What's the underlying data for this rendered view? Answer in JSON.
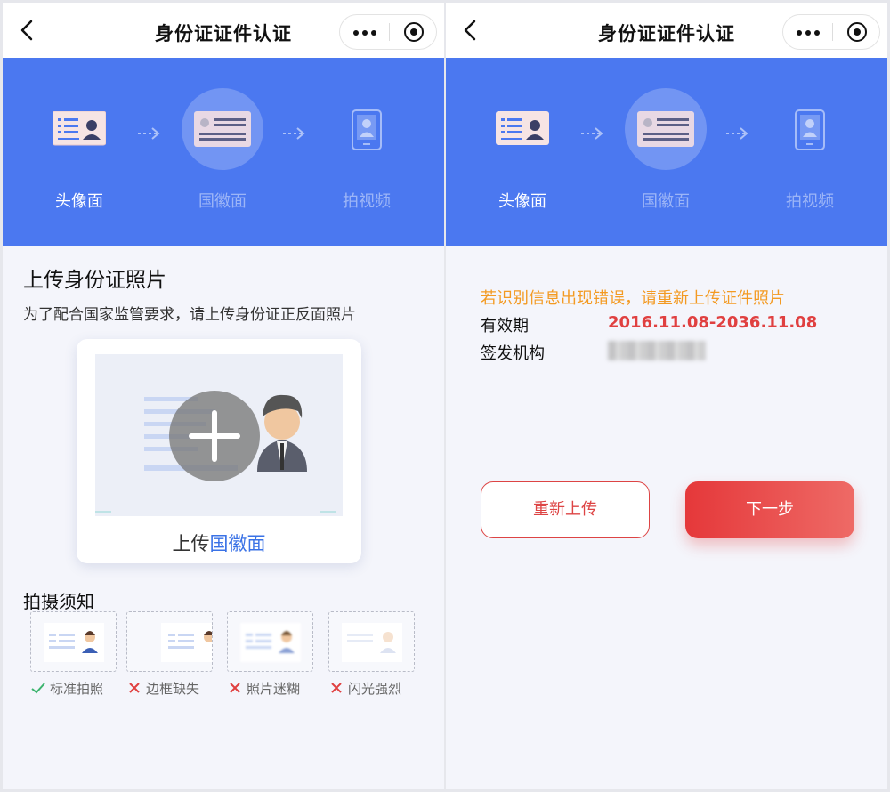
{
  "nav": {
    "title": "身份证证件认证"
  },
  "steps": [
    {
      "label": "头像面",
      "state": "done"
    },
    {
      "label": "国徽面",
      "state": "current"
    },
    {
      "label": "拍视频",
      "state": "pending"
    }
  ],
  "left": {
    "title": "上传身份证照片",
    "description": "为了配合国家监管要求，请上传身份证正反面照片",
    "upload_prefix": "上传",
    "upload_side": "国徽面",
    "tips_title": "拍摄须知",
    "tips": [
      {
        "label": "标准拍照",
        "ok": true
      },
      {
        "label": "边框缺失",
        "ok": false
      },
      {
        "label": "照片迷糊",
        "ok": false
      },
      {
        "label": "闪光强烈",
        "ok": false
      }
    ]
  },
  "right": {
    "warning": "若识别信息出现错误，请重新上传证件照片",
    "validity_label": "有效期",
    "validity_value": "2016.11.08-2036.11.08",
    "authority_label": "签发机构",
    "reupload_label": "重新上传",
    "next_label": "下一步"
  },
  "colors": {
    "banner": "#4b78f0",
    "accent_red": "#e5383a",
    "warning": "#f39a22",
    "link_blue": "#3a72e6"
  }
}
